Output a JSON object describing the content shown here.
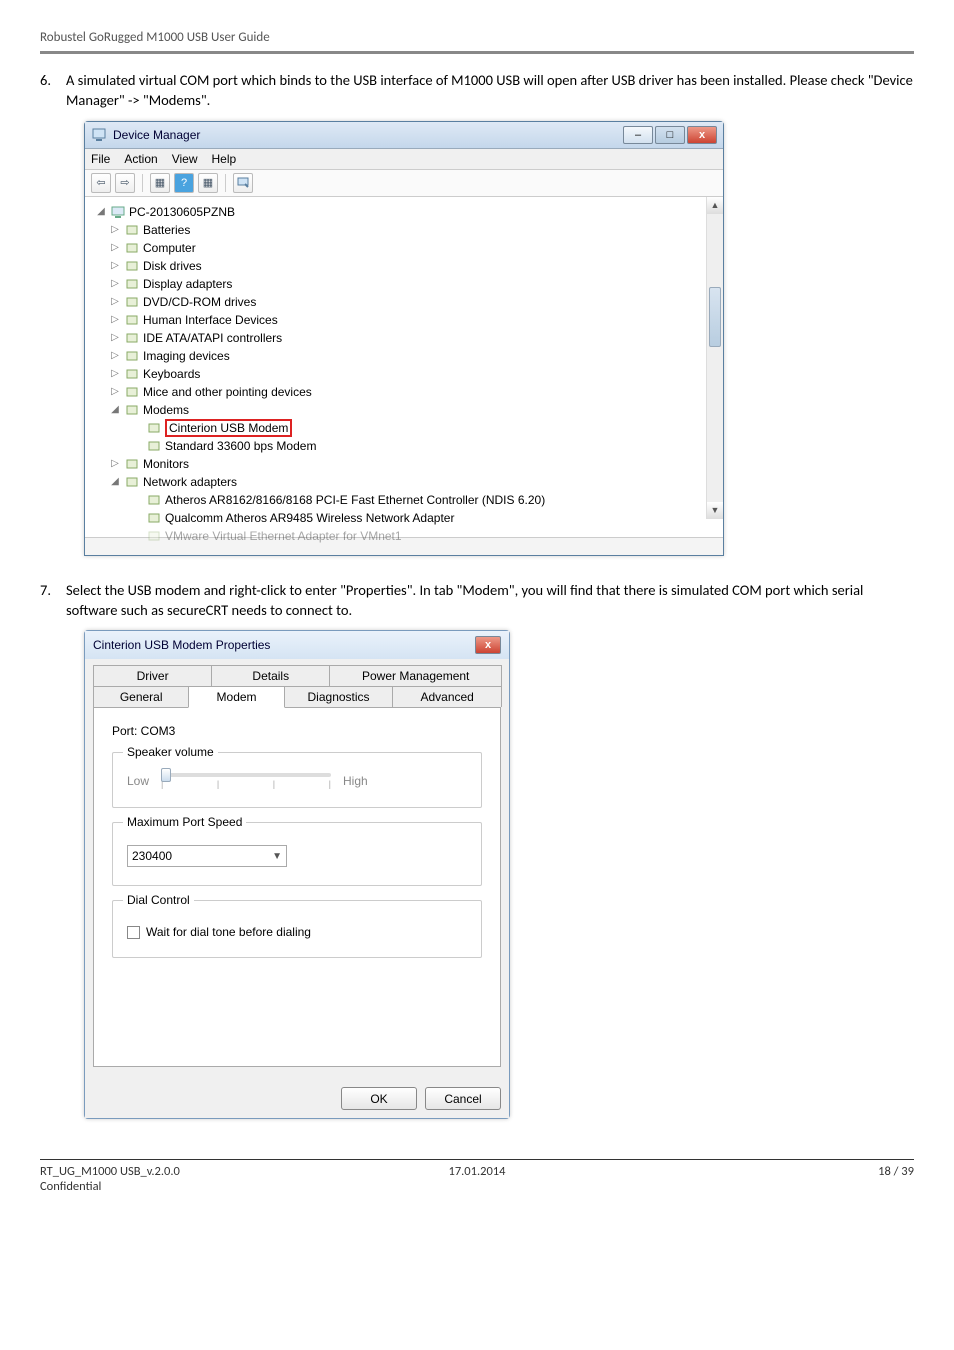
{
  "doc_header": "Robustel GoRugged M1000 USB User Guide",
  "step6": {
    "num": "6.",
    "text": "A simulated virtual COM port which binds to the USB interface of M1000 USB will open after USB driver has been installed. Please check \"Device Manager\" -> \"Modems\"."
  },
  "device_manager": {
    "title": "Device Manager",
    "menu": {
      "file": "File",
      "action": "Action",
      "view": "View",
      "help": "Help"
    },
    "win_btns": {
      "min": "–",
      "max": "□",
      "close": "x"
    },
    "root": "PC-20130605PZNB",
    "nodes": [
      {
        "label": "Batteries",
        "arrow": "▷"
      },
      {
        "label": "Computer",
        "arrow": "▷"
      },
      {
        "label": "Disk drives",
        "arrow": "▷"
      },
      {
        "label": "Display adapters",
        "arrow": "▷"
      },
      {
        "label": "DVD/CD-ROM drives",
        "arrow": "▷"
      },
      {
        "label": "Human Interface Devices",
        "arrow": "▷"
      },
      {
        "label": "IDE ATA/ATAPI controllers",
        "arrow": "▷"
      },
      {
        "label": "Imaging devices",
        "arrow": "▷"
      },
      {
        "label": "Keyboards",
        "arrow": "▷"
      },
      {
        "label": "Mice and other pointing devices",
        "arrow": "▷"
      },
      {
        "label": "Modems",
        "arrow": "◢",
        "expanded": true
      },
      {
        "label": "Cinterion USB Modem",
        "child": true,
        "highlight": true
      },
      {
        "label": "Standard 33600 bps Modem",
        "child": true
      },
      {
        "label": "Monitors",
        "arrow": "▷"
      },
      {
        "label": "Network adapters",
        "arrow": "◢",
        "expanded": true
      },
      {
        "label": "Atheros AR8162/8166/8168 PCI-E Fast Ethernet Controller (NDIS 6.20)",
        "child": true
      },
      {
        "label": "Qualcomm Atheros AR9485 Wireless Network Adapter",
        "child": true
      },
      {
        "label": "VMware Virtual Ethernet Adapter for VMnet1",
        "child": true,
        "cut": true
      }
    ]
  },
  "step7": {
    "num": "7.",
    "text": "Select the USB modem and right-click to enter \"Properties\". In tab \"Modem\", you will find that there is simulated COM port which serial software such as secureCRT needs to connect to."
  },
  "properties": {
    "title": "Cinterion USB Modem Properties",
    "close": "x",
    "tabs_row1": {
      "driver": "Driver",
      "details": "Details",
      "power": "Power Management"
    },
    "tabs_row2": {
      "general": "General",
      "modem": "Modem",
      "diag": "Diagnostics",
      "adv": "Advanced"
    },
    "port_label": "Port:  COM3",
    "speaker": {
      "title": "Speaker volume",
      "low": "Low",
      "high": "High"
    },
    "maxspeed": {
      "title": "Maximum Port Speed",
      "value": "230400"
    },
    "dial": {
      "title": "Dial Control",
      "checkbox": "Wait for dial tone before dialing"
    },
    "buttons": {
      "ok": "OK",
      "cancel": "Cancel"
    }
  },
  "footer": {
    "left_line1": "RT_UG_M1000 USB_v.2.0.0",
    "left_line2": "Confidential",
    "mid": "17.01.2014",
    "right": "18 / 39"
  }
}
